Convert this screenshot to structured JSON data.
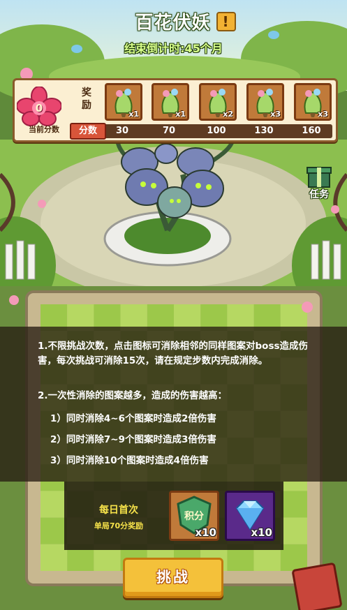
{
  "header": {
    "title": "百花伏妖",
    "info_icon": "exclamation-icon",
    "info_glyph": "!",
    "countdown": "结束倒计时:45个月"
  },
  "reward_panel": {
    "current_score_value": "0",
    "current_score_label": "当前分数",
    "reward_label": "奖励",
    "score_label": "分数",
    "rewards": [
      {
        "icon": "herb-bundle-icon",
        "qty": "x1",
        "score": "30"
      },
      {
        "icon": "herb-bundle-icon",
        "qty": "x1",
        "score": "70"
      },
      {
        "icon": "herb-bundle-icon",
        "qty": "x2",
        "score": "100"
      },
      {
        "icon": "herb-bundle-icon",
        "qty": "x3",
        "score": "130"
      },
      {
        "icon": "herb-bundle-icon",
        "qty": "x3",
        "score": "160"
      }
    ]
  },
  "task": {
    "label": "任务",
    "icon": "gift-box-icon"
  },
  "rules": {
    "rule1": "1.不限挑战次数，点击图标可消除相邻的同样图案对boss造成伤害，每次挑战可消除15次，请在规定步数内完成消除。",
    "rule2": "2.一次性消除的图案越多，造成的伤害越高：",
    "sub1": "1）同时消除4~6个图案时造成2倍伤害",
    "sub2": "2）同时消除7~9个图案时造成3倍伤害",
    "sub3": "3）同时消除10个图案时造成4倍伤害"
  },
  "daily": {
    "title": "每日首次",
    "subtitle": "单局70分奖励",
    "prizes": [
      {
        "icon": "points-token-icon",
        "token_text": "积分",
        "qty": "x10",
        "color": "#4aa86a"
      },
      {
        "icon": "diamond-icon",
        "qty": "x10",
        "color": "#8a4fd0"
      }
    ]
  },
  "actions": {
    "challenge": "挑战"
  },
  "colors": {
    "panel_bg": "#fbefd2",
    "panel_border": "#8a5a2b",
    "accent_yellow": "#f4c13a",
    "flower_pink": "#e8456e",
    "countdown_green": "#d9ff8c"
  }
}
